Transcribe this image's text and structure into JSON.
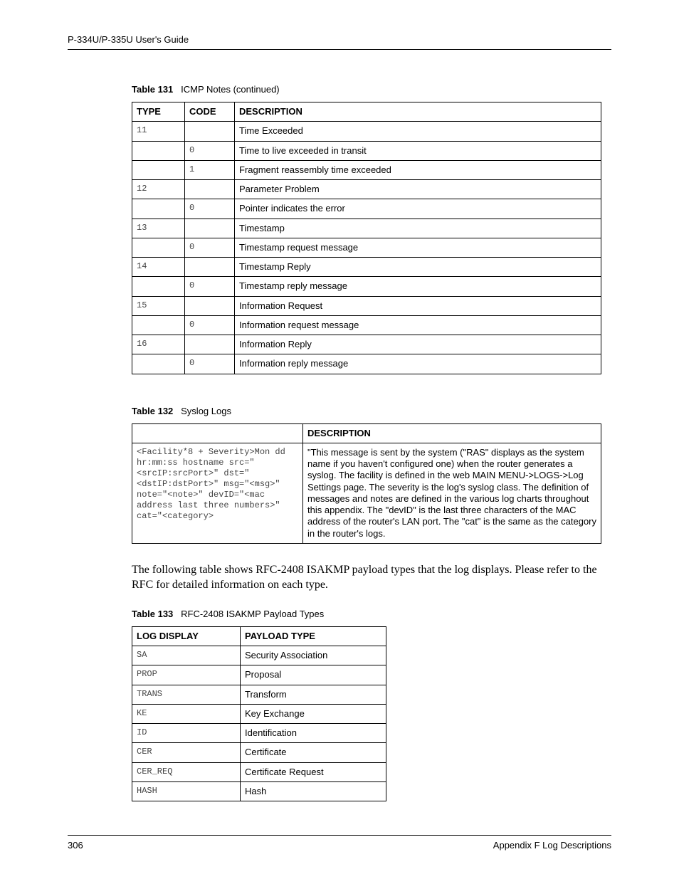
{
  "header": {
    "guide_title": "P-334U/P-335U User's Guide"
  },
  "table131": {
    "num": "Table 131",
    "title": "ICMP Notes (continued)",
    "headers": {
      "type": "TYPE",
      "code": "CODE",
      "desc": "DESCRIPTION"
    },
    "rows": [
      {
        "type": "11",
        "code": "",
        "desc": "Time Exceeded"
      },
      {
        "type": "",
        "code": "0",
        "desc": "Time to live exceeded in transit"
      },
      {
        "type": "",
        "code": "1",
        "desc": "Fragment reassembly time exceeded"
      },
      {
        "type": "12",
        "code": "",
        "desc": "Parameter Problem"
      },
      {
        "type": "",
        "code": "0",
        "desc": "Pointer indicates the error"
      },
      {
        "type": "13",
        "code": "",
        "desc": "Timestamp"
      },
      {
        "type": "",
        "code": "0",
        "desc": "Timestamp request message"
      },
      {
        "type": "14",
        "code": "",
        "desc": "Timestamp Reply"
      },
      {
        "type": "",
        "code": "0",
        "desc": "Timestamp reply message"
      },
      {
        "type": "15",
        "code": "",
        "desc": "Information Request"
      },
      {
        "type": "",
        "code": "0",
        "desc": "Information request message"
      },
      {
        "type": "16",
        "code": "",
        "desc": "Information Reply"
      },
      {
        "type": "",
        "code": "0",
        "desc": "Information reply message"
      }
    ]
  },
  "table132": {
    "num": "Table 132",
    "title": "Syslog Logs",
    "headers": {
      "blank": "",
      "desc": "DESCRIPTION"
    },
    "row": {
      "format": "<Facility*8 + Severity>Mon dd hr:mm:ss hostname src=\"<srcIP:srcPort>\" dst=\"<dstIP:dstPort>\" msg=\"<msg>\" note=\"<note>\" devID=\"<mac address last three numbers>\" cat=\"<category>",
      "desc": "\"This message is sent by the system (\"RAS\" displays as the system name if you haven't configured one) when the router generates a syslog. The facility is defined in the web MAIN MENU->LOGS->Log Settings page. The severity is the log's syslog class. The definition of messages and notes are defined in the various log charts throughout this appendix. The \"devID\" is the last three characters of the MAC address of the router's LAN port. The \"cat\" is the same as the category in the router's logs."
    }
  },
  "paragraph": "The following table shows RFC-2408 ISAKMP payload types that the log displays. Please refer to the RFC for detailed information on each type.",
  "table133": {
    "num": "Table 133",
    "title": "RFC-2408 ISAKMP Payload Types",
    "headers": {
      "log": "LOG DISPLAY",
      "payload": "PAYLOAD TYPE"
    },
    "rows": [
      {
        "log": "SA",
        "payload": "Security Association"
      },
      {
        "log": "PROP",
        "payload": "Proposal"
      },
      {
        "log": "TRANS",
        "payload": "Transform"
      },
      {
        "log": "KE",
        "payload": "Key Exchange"
      },
      {
        "log": "ID",
        "payload": "Identification"
      },
      {
        "log": "CER",
        "payload": "Certificate"
      },
      {
        "log": "CER_REQ",
        "payload": "Certificate Request"
      },
      {
        "log": "HASH",
        "payload": "Hash"
      }
    ]
  },
  "footer": {
    "page": "306",
    "appendix": "Appendix F Log Descriptions"
  }
}
